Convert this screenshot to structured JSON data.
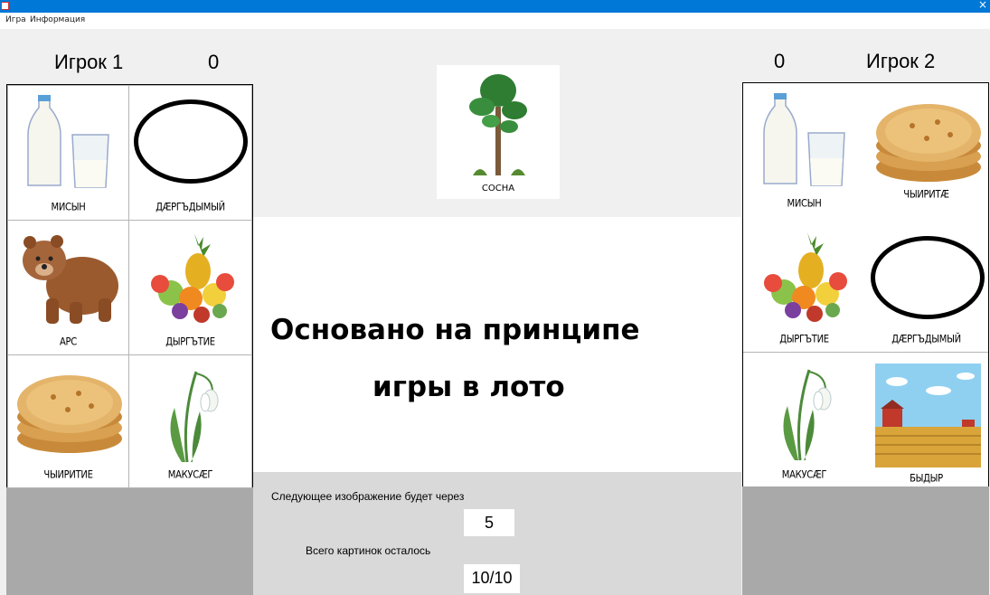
{
  "menu": {
    "items": [
      "Игра",
      "Информация"
    ]
  },
  "player1": {
    "name": "Игрок 1",
    "score": "0",
    "cards": [
      "МИСЫН",
      "ДÆРГЪДЫМЫЙ",
      "АРС",
      "ДЫРГЪТИЕ",
      "ЧЫИРИТИЕ",
      "МАКУСÆГ"
    ]
  },
  "player2": {
    "name": "Игрок 2",
    "score": "0",
    "cards": [
      "МИСЫН",
      "ЧЫИРИТÆ",
      "ДЫРГЪТИЕ",
      "ДÆРГЪДЫМЫЙ",
      "МАКУСÆГ",
      "БЫДЫР"
    ]
  },
  "current": {
    "caption": "СОСНА"
  },
  "center": {
    "line1": "Основано на принципе",
    "line2": "игры в лото"
  },
  "timer": {
    "label": "Следующее изображение будет через",
    "value": "5"
  },
  "remaining": {
    "label": "Всего картинок осталось",
    "value": "10/10"
  }
}
